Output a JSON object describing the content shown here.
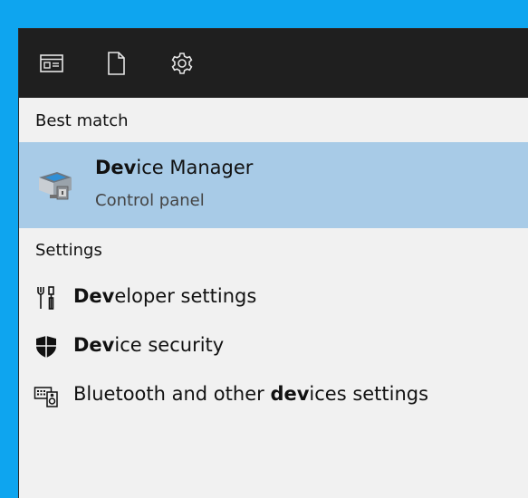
{
  "topbar": {
    "icons": [
      "apps-view-icon",
      "document-icon",
      "settings-gear-icon"
    ]
  },
  "best_match": {
    "header": "Best match",
    "item": {
      "title_bold": "Dev",
      "title_rest": "ice Manager",
      "subtitle": "Control panel",
      "icon": "device-manager-icon"
    }
  },
  "settings": {
    "header": "Settings",
    "items": [
      {
        "bold": "Dev",
        "pre": "",
        "post": "eloper settings",
        "icon": "developer-tools-icon"
      },
      {
        "bold": "Dev",
        "pre": "",
        "post": "ice security",
        "icon": "shield-icon"
      },
      {
        "bold": "dev",
        "pre": "Bluetooth and other ",
        "post": "ices settings",
        "icon": "bluetooth-devices-icon"
      }
    ]
  },
  "colors": {
    "background": "#0ea5ef",
    "topbar": "#1f1f1f",
    "panel": "#f1f1f1",
    "selected": "#a8cbe7"
  }
}
